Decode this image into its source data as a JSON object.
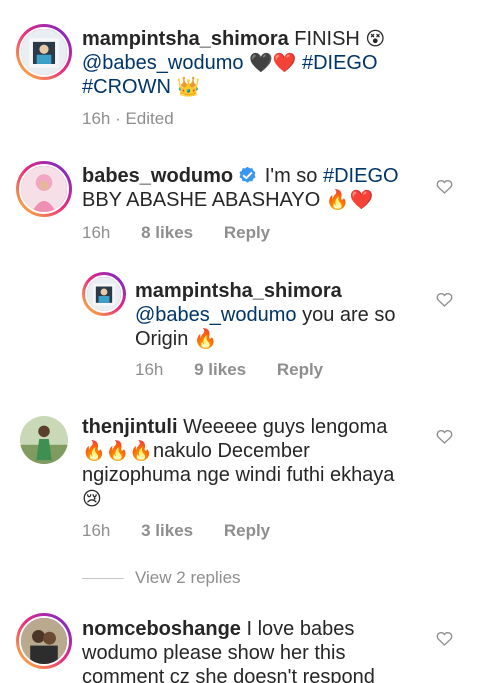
{
  "caption": {
    "username": "mampintsha_shimora",
    "text1": "FINISH",
    "emoji1": "😵",
    "mention": "@babes_wodumo",
    "emoji2": "🖤❤️",
    "tag1": "#DIEGO",
    "tag2": "#CROWN",
    "emoji3": "👑",
    "time": "16h · Edited"
  },
  "comments": [
    {
      "username": "babes_wodumo",
      "verified": true,
      "text_a": "I'm so",
      "tag": "#DIEGO",
      "text_b": "BBY ABASHE ABASHAYO",
      "emoji": "🔥❤️",
      "time": "16h",
      "likes": "8 likes",
      "reply": "Reply"
    },
    {
      "username": "mampintsha_shimora",
      "mention": "@babes_wodumo",
      "text_a": "you are so",
      "text_b": "Origin",
      "emoji": "🔥",
      "time": "16h",
      "likes": "9 likes",
      "reply": "Reply"
    },
    {
      "username": "thenjintuli",
      "text_a": "Weeeee guys lengoma",
      "emoji_a": "🔥🔥🔥",
      "text_b": "nakulo December",
      "text_c": "ngizophuma nge windi futhi ekhaya",
      "emoji_b": "😢",
      "time": "16h",
      "likes": "3 likes",
      "reply": "Reply"
    },
    {
      "username": "nomceboshange",
      "text_a": "I love babes",
      "text_b": "wodumo  please  show her this",
      "text_c": "comment  cz she doesn't  respond"
    }
  ],
  "view_replies": "View 2 replies",
  "icons": {
    "heart": "heart-outline-icon",
    "verified": "verified-badge-icon"
  },
  "colors": {
    "link": "#003569",
    "meta": "#8e8e8e",
    "verified": "#3897f0"
  }
}
